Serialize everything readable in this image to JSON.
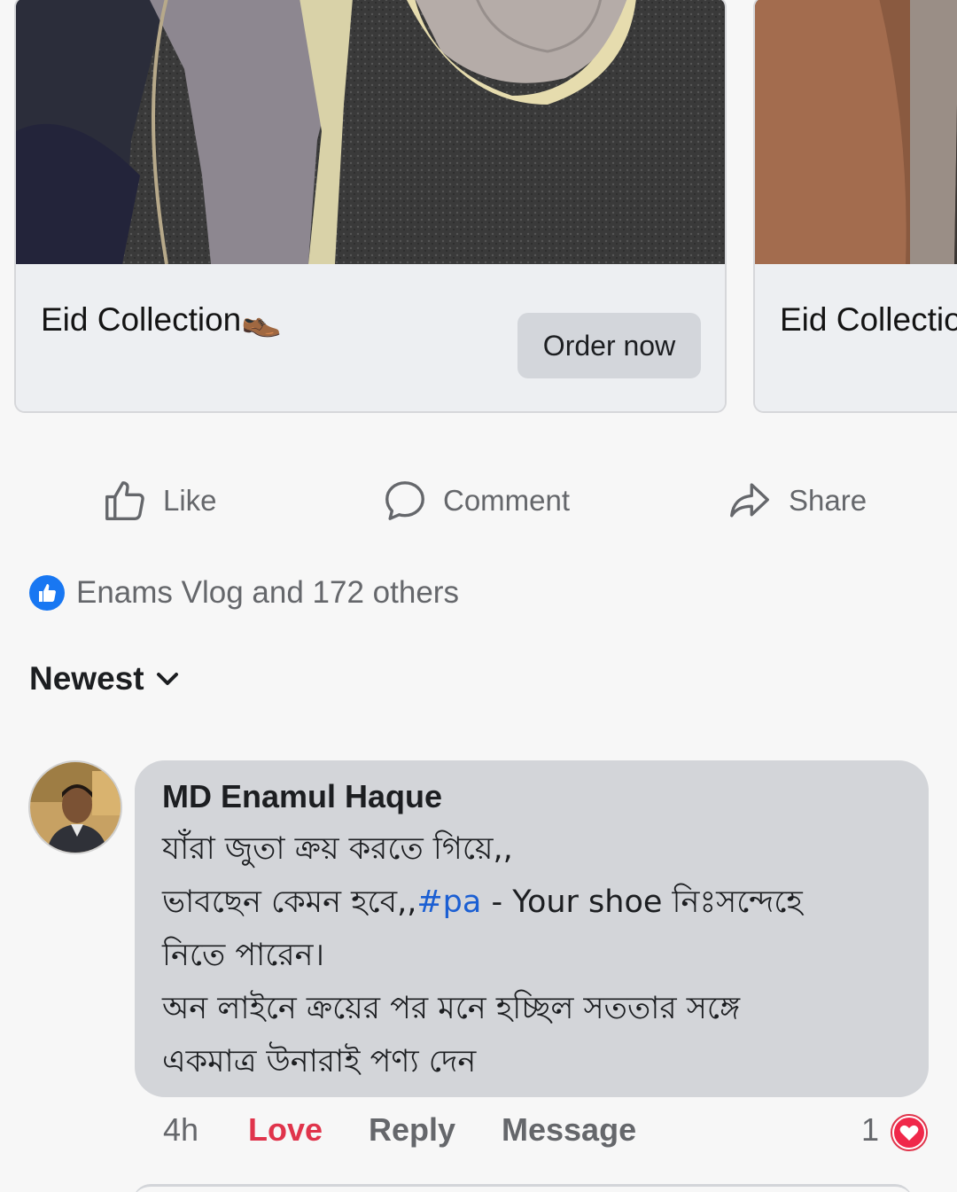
{
  "carousel": {
    "cards": [
      {
        "title": "Eid Collection",
        "emoji": "👞",
        "button": "Order now"
      },
      {
        "title": "Eid Collection"
      }
    ]
  },
  "actions": {
    "like": "Like",
    "comment": "Comment",
    "share": "Share"
  },
  "reactions": {
    "summary": "Enams Vlog and 172 others"
  },
  "sort": {
    "label": "Newest"
  },
  "comment": {
    "author": "MD Enamul Haque",
    "line1": "যাঁরা জুতা ক্রয় করতে গিয়ে,,",
    "line2_before": "ভাবছেন কেমন হবে,,",
    "hashtag": "#pa",
    "line2_after": " - Your shoe নিঃসন্দেহে",
    "line3": "নিতে পারেন।",
    "line4": "অন লাইনে ক্রয়ের পর মনে হচ্ছিল সততার সঙ্গে",
    "line5": "একমাত্র উনারাই পণ্য দেন",
    "time": "4h",
    "reaction_label": "Love",
    "reply": "Reply",
    "message": "Message",
    "reaction_count": "1"
  },
  "colors": {
    "link": "#1b5fd3",
    "love": "#e0344b",
    "like_blue": "#1877f2",
    "muted": "#65676b"
  }
}
